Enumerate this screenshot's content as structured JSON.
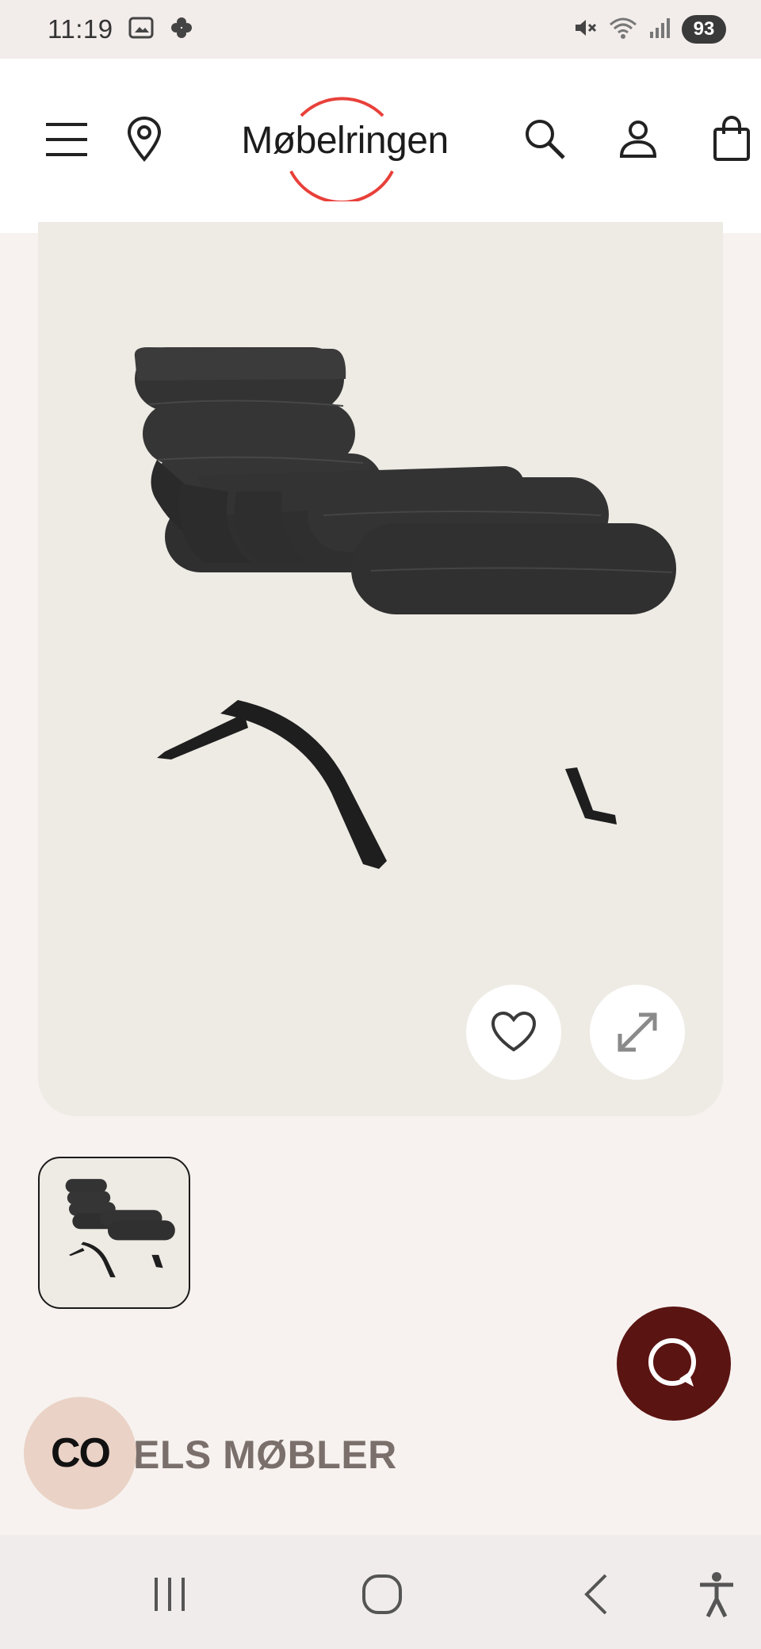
{
  "status": {
    "time": "11:19",
    "battery": "93"
  },
  "header": {
    "logo": "Møbelringen",
    "colors": {
      "logo_ring": "#e8403a",
      "icon": "#222222"
    },
    "icons": [
      "menu-icon",
      "location-pin-icon",
      "search-icon",
      "account-icon",
      "shopping-bag-icon"
    ]
  },
  "product": {
    "image": "black-chaise-lounge",
    "thumbnail_count": 1,
    "actions": [
      "favorite-heart-icon",
      "expand-icon"
    ]
  },
  "brand": {
    "heading": "ELS MØBLER",
    "badge": "CO"
  },
  "chat": {
    "color": "#5a1412",
    "icon": "chat-bubble-icon"
  },
  "navbar": {
    "icons": [
      "recent-apps-icon",
      "home-icon",
      "back-icon",
      "accessibility-icon"
    ]
  }
}
